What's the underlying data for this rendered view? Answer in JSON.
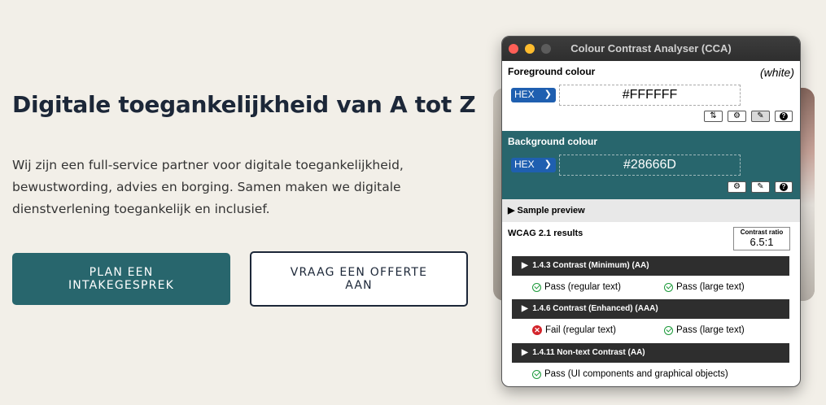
{
  "hero": {
    "title": "Digitale toegankelijkheid van A tot Z",
    "description": "Wij zijn een full-service partner voor digitale toegankelijkheid, bewustwording, advies en borging. Samen maken we digitale dienstverlening toegankelijk en inclusief.",
    "primary_button": "PLAN EEN INTAKEGESPREK",
    "secondary_button": "VRAAG EEN OFFERTE AAN"
  },
  "cca": {
    "window_title": "Colour Contrast Analyser (CCA)",
    "foreground": {
      "label": "Foreground colour",
      "name": "(white)",
      "format": "HEX",
      "value": "#FFFFFF",
      "icons": [
        "swap-icon",
        "sliders-icon",
        "eyedropper-icon",
        "help-icon"
      ]
    },
    "background": {
      "label": "Background colour",
      "format": "HEX",
      "value": "#28666D",
      "icons": [
        "sliders-icon",
        "eyedropper-icon",
        "help-icon"
      ]
    },
    "sample_preview": "Sample preview",
    "wcag": {
      "title": "WCAG 2.1 results",
      "ratio_label": "Contrast ratio",
      "ratio_value": "6.5:1",
      "criteria": [
        {
          "label": "1.4.3 Contrast (Minimum) (AA)",
          "results": [
            {
              "status": "pass",
              "text": "Pass (regular text)"
            },
            {
              "status": "pass",
              "text": "Pass (large text)"
            }
          ]
        },
        {
          "label": "1.4.6 Contrast (Enhanced) (AAA)",
          "results": [
            {
              "status": "fail",
              "text": "Fail (regular text)"
            },
            {
              "status": "pass",
              "text": "Pass (large text)"
            }
          ]
        },
        {
          "label": "1.4.11 Non-text Contrast (AA)",
          "results": [
            {
              "status": "pass",
              "text": "Pass (UI components and graphical objects)"
            }
          ]
        }
      ]
    }
  },
  "colors": {
    "page_bg": "#f2efe8",
    "brand_teal": "#28666d",
    "text_dark": "#1c2738"
  }
}
